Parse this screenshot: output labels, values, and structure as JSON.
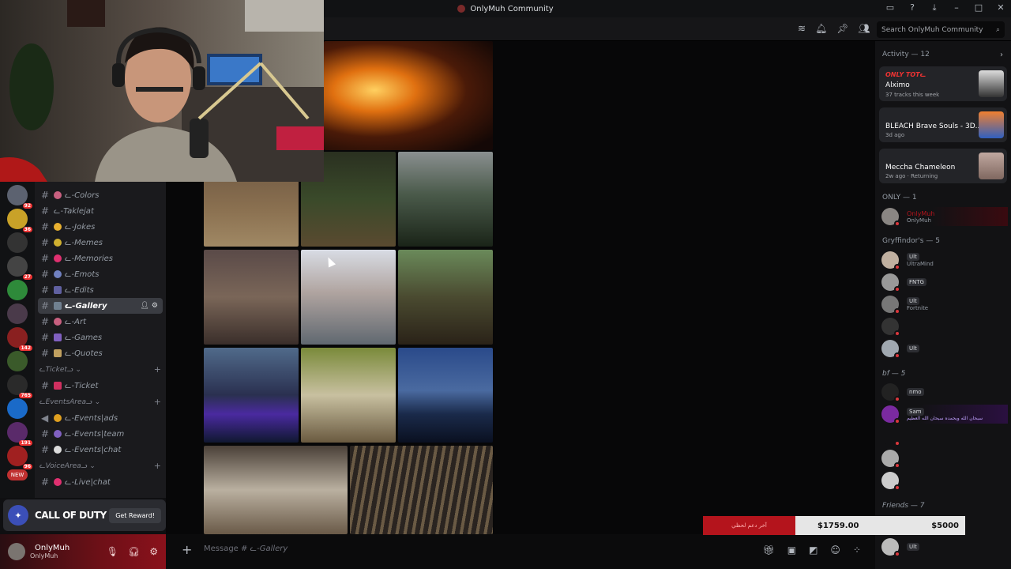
{
  "window": {
    "title": "OnlyMuh Community"
  },
  "header": {
    "search_placeholder": "Search OnlyMuh Community"
  },
  "server_badges": [
    "92",
    "36",
    "27",
    "142",
    "765",
    "191",
    "96"
  ],
  "new_badge": "NEW",
  "channels": [
    {
      "label": "ᓚ-Colors",
      "emoji": "#c86080"
    },
    {
      "label": "ᓚ-Taklejat",
      "emoji": null
    },
    {
      "label": "ᓚ-Jokes",
      "emoji": "#e8b030"
    },
    {
      "label": "ᓚ-Memes",
      "emoji": "#d0b030"
    },
    {
      "label": "ᓚ-Memories",
      "emoji": "#e03070"
    },
    {
      "label": "ᓚ-Emots",
      "emoji": "#7080c0"
    },
    {
      "label": "ᓚ-Edits",
      "emoji": "#6060a0"
    },
    {
      "label": "ᓚ-Gallery",
      "emoji": "#708090",
      "selected": true
    },
    {
      "label": "ᓚ-Art",
      "emoji": "#c86080"
    },
    {
      "label": "ᓚ-Games",
      "emoji": "#8060c0"
    },
    {
      "label": "ᓚ-Quotes",
      "emoji": "#c0a060"
    }
  ],
  "categories": {
    "ticket": {
      "label": "ᓚTicketᓗ ⌄",
      "channel": "ᓚ-Ticket"
    },
    "events": {
      "label": "ᓚEventsAreaᓗ ⌄",
      "channels": [
        "ᓚ-Events|ads",
        "ᓚ-Events|team",
        "ᓚ-Events|chat"
      ]
    },
    "voice": {
      "label": "ᓚVoiceAreaᓗ ⌄",
      "channel": "ᓚ-Live|chat"
    }
  },
  "promo": {
    "logo": "CALL OF DUTY",
    "button": "Get Reward!"
  },
  "user": {
    "name": "OnlyMuh",
    "status": "OnlyMuh"
  },
  "composer": {
    "placeholder_prefix": "Message #",
    "channel": "ᓚ-Gallery"
  },
  "activity": {
    "header": "Activity — 12",
    "cards": [
      {
        "tag": "ONLY TOTᓚ",
        "name": "Alximo",
        "detail": "37 tracks this week"
      },
      {
        "name": "BLEACH Brave Souls - 3D...",
        "detail": "3d ago"
      },
      {
        "name": "Meccha Chameleon",
        "detail": "2w ago · Returning"
      }
    ]
  },
  "groups": {
    "only": "ONLY — 1",
    "gryff": "Gryffindor's — 5",
    "bf": "bf — 5",
    "friends": "Friends — 7"
  },
  "members": {
    "onlymuh": {
      "name": "OnlyMuh",
      "sub": "OnlyMuh"
    },
    "g1": {
      "tag": "Ult",
      "sub": "UltraMind"
    },
    "g2": {
      "tag": "FNTG"
    },
    "g3": {
      "tag": "Ult",
      "sub": "Fortnite"
    },
    "g5": {
      "tag": "Ult"
    },
    "bf1": {
      "tag": "nmo"
    },
    "bf2": {
      "tag": "Sam",
      "sub": "سبحان الله وبحمده سبحان الله العظيم"
    },
    "fr1": {
      "tag": "Ult"
    }
  },
  "donation": {
    "label": "آخر دعم لحظي",
    "current": "$1759.00",
    "goal": "$5000"
  },
  "colors": {
    "accent": "#b4141c",
    "selected": "#3a3c42"
  }
}
